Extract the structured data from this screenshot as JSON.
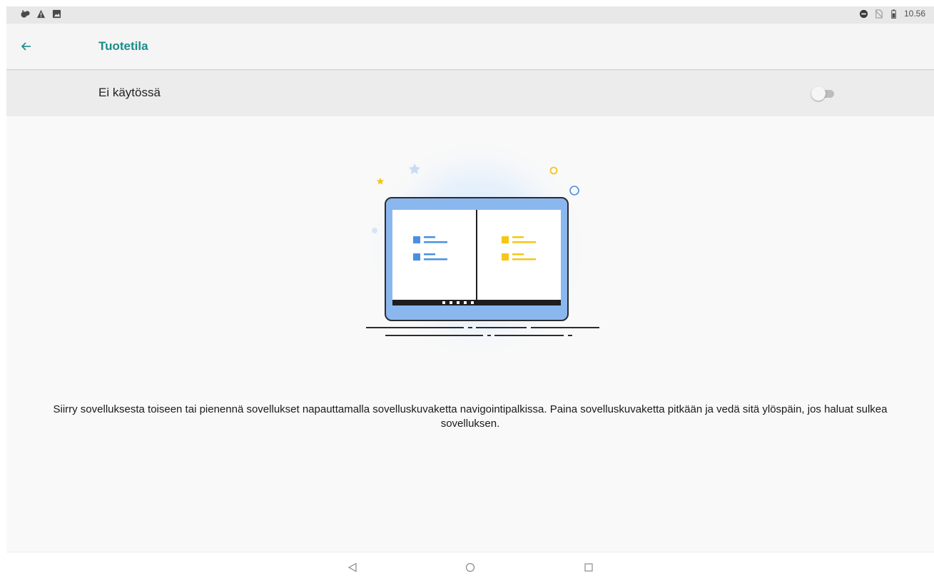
{
  "status_bar": {
    "left_icons": [
      "cat-notification-icon",
      "warning-icon",
      "image-notification-icon"
    ],
    "right_icons": [
      "do-not-disturb-icon",
      "no-sim-icon",
      "battery-icon"
    ],
    "time": "10.56"
  },
  "app_bar": {
    "back_icon": "arrow-left-icon",
    "title": "Tuotetila"
  },
  "toggle_row": {
    "label": "Ei käytössä",
    "checked": false
  },
  "description": "Siirry sovelluksesta toiseen tai pienennä sovellukset napauttamalla sovelluskuvaketta navigointipalkissa. Paina sovelluskuvaketta pitkään ja vedä sitä ylöspäin, jos haluat sulkea sovelluksen.",
  "nav_bar": {
    "back_icon": "triangle-back-icon",
    "home_icon": "circle-home-icon",
    "recents_icon": "square-recents-icon"
  },
  "colors": {
    "accent": "#1b8c8a",
    "illustration_blue": "#4a90e2",
    "illustration_yellow": "#f5c518"
  }
}
